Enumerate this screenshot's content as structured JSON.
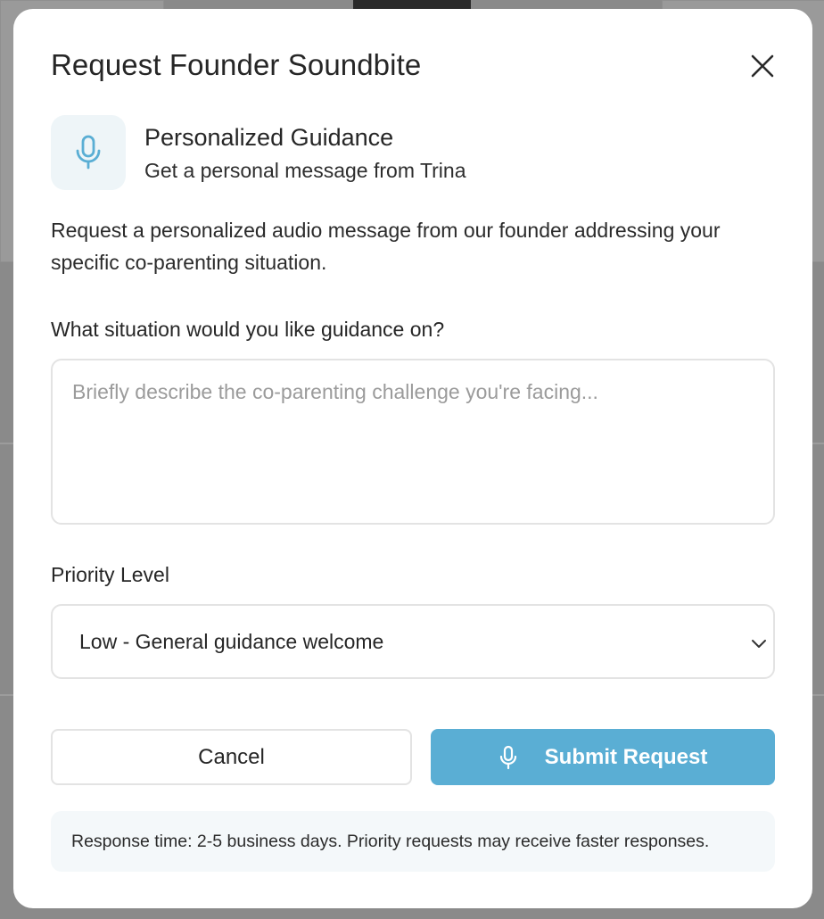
{
  "modal": {
    "title": "Request Founder Soundbite",
    "close_icon": "close-icon"
  },
  "feature": {
    "icon": "microphone-icon",
    "title": "Personalized Guidance",
    "subtitle": "Get a personal message from Trina"
  },
  "description": "Request a personalized audio message from our founder addressing your specific co-parenting situation.",
  "situation": {
    "label": "What situation would you like guidance on?",
    "placeholder": "Briefly describe the co-parenting challenge you're facing...",
    "value": ""
  },
  "priority": {
    "label": "Priority Level",
    "selected": "Low - General guidance welcome",
    "icon": "chevron-down-icon"
  },
  "actions": {
    "cancel_label": "Cancel",
    "submit_label": "Submit Request",
    "submit_icon": "microphone-icon"
  },
  "info": {
    "text": "Response time: 2-5 business days. Priority requests may receive faster responses."
  },
  "colors": {
    "accent": "#5aaed4",
    "icon_bg": "#eef5f8",
    "info_bg": "#f4f8fa",
    "overlay": "#8a8a8a"
  }
}
